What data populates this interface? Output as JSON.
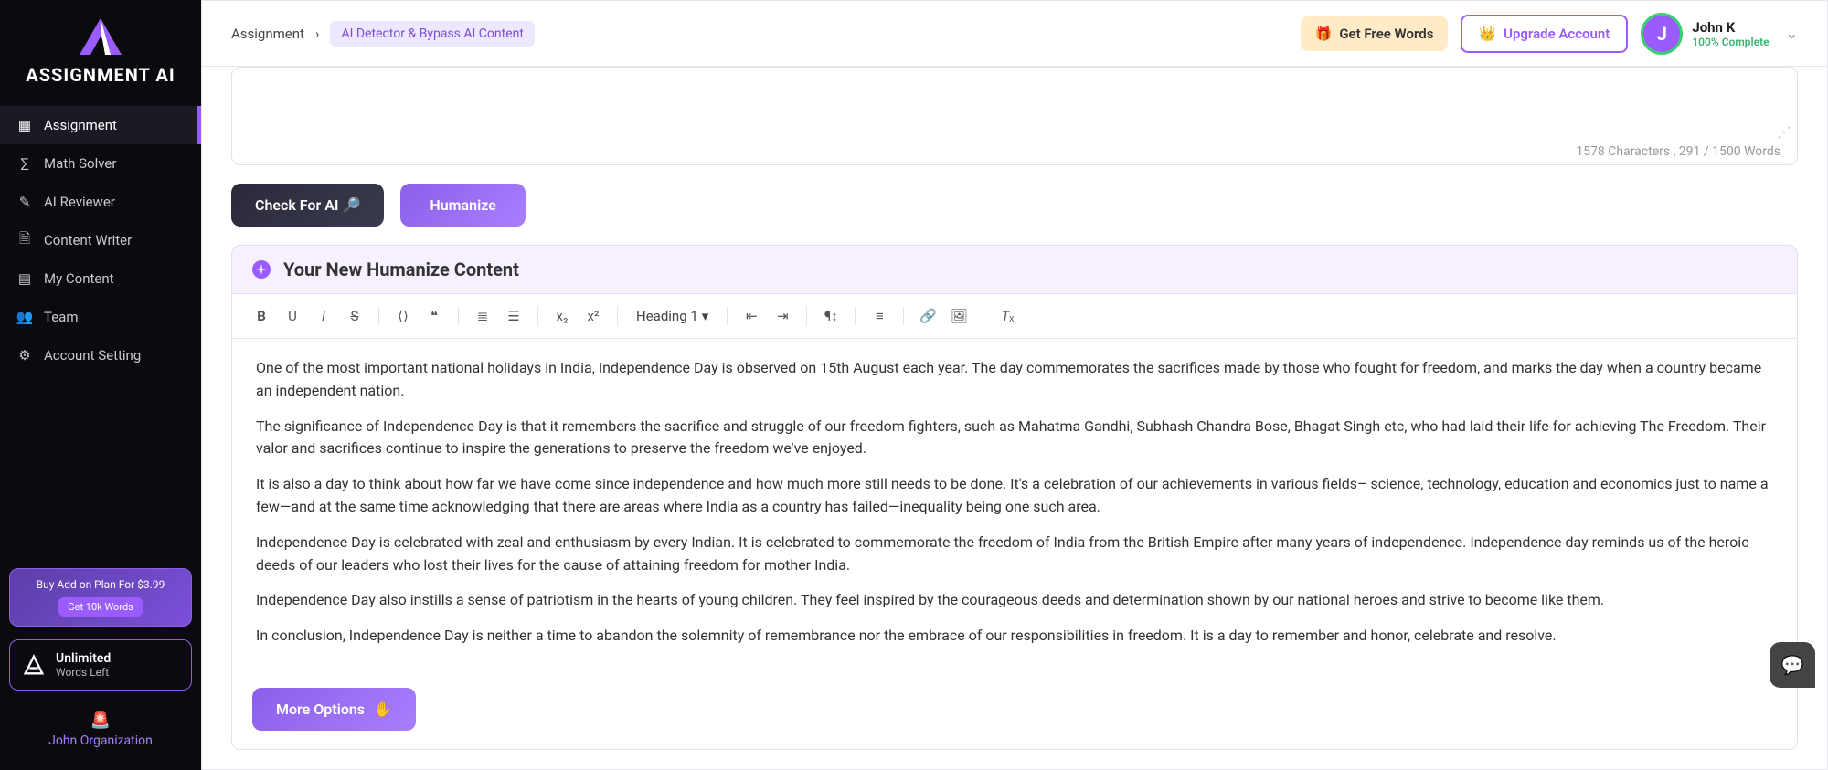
{
  "brand": "ASSIGNMENT AI",
  "sidebar": {
    "items": [
      {
        "label": "Assignment",
        "icon": "grid"
      },
      {
        "label": "Math Solver",
        "icon": "math"
      },
      {
        "label": "AI Reviewer",
        "icon": "review"
      },
      {
        "label": "Content Writer",
        "icon": "doc"
      },
      {
        "label": "My Content",
        "icon": "file"
      },
      {
        "label": "Team",
        "icon": "team"
      },
      {
        "label": "Account Setting",
        "icon": "gear"
      }
    ],
    "addon": {
      "title": "Buy Add on Plan For $3.99",
      "cta": "Get 10k Words"
    },
    "unlimited": {
      "line1": "Unlimited",
      "line2": "Words Left"
    },
    "org": "John Organization"
  },
  "breadcrumb": {
    "root": "Assignment",
    "current": "AI Detector & Bypass AI Content"
  },
  "top": {
    "free_words": "Get Free Words",
    "upgrade": "Upgrade Account",
    "user_name": "John K",
    "user_initial": "J",
    "completion": "100% Complete"
  },
  "counter": "1578 Characters , 291 / 1500 Words",
  "buttons": {
    "check": "Check For AI 🔎",
    "humanize": "Humanize",
    "more": "More Options"
  },
  "result_title": "Your New Humanize Content",
  "heading_select": "Heading 1",
  "paragraphs": [
    "One of the most important national holidays in India, Independence Day is observed on 15th August each year. The day commemorates the sacrifices made by those who fought for freedom, and marks the day when a country became an independent nation.",
    "The significance of Independence Day is that it remembers the sacrifice and struggle of our freedom fighters, such as Mahatma Gandhi, Subhash Chandra Bose, Bhagat Singh etc, who had laid their life for achieving The Freedom. Their valor and sacrifices continue to inspire the generations to preserve the freedom we've enjoyed.",
    "It is also a day to think about how far we have come since independence and how much more still needs to be done. It's a celebration of our achievements in various fields– science, technology, education and economics just to name a few—and at the same time acknowledging that there are areas where India as a country has failed—inequality being one such area.",
    "Independence Day is celebrated with zeal and enthusiasm by every Indian. It is celebrated to commemorate the freedom of India from the British Empire after many years of independence. Independence day reminds us of the heroic deeds of our leaders who lost their lives for the cause of attaining freedom for mother India.",
    "Independence Day also instills a sense of patriotism in the hearts of young children. They feel inspired by the courageous deeds and determination shown by our national heroes and strive to become like them.",
    "In conclusion, Independence Day is neither a time to abandon the solemnity of remembrance nor the embrace of our responsibilities in freedom. It is a day to remember and honor, celebrate and resolve."
  ]
}
